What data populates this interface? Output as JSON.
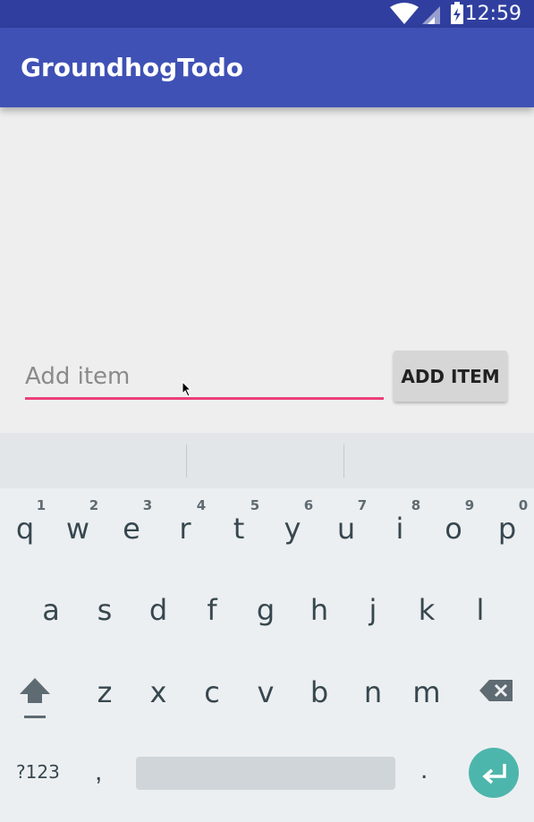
{
  "status_bar": {
    "time": "12:59",
    "icons": [
      "wifi-icon",
      "cell-signal-icon",
      "battery-charging-icon"
    ]
  },
  "app_bar": {
    "title": "GroundhogTodo"
  },
  "form": {
    "placeholder": "Add item",
    "add_button_label": "ADD ITEM"
  },
  "keyboard": {
    "row1": [
      "q",
      "w",
      "e",
      "r",
      "t",
      "y",
      "u",
      "i",
      "o",
      "p"
    ],
    "row1_hints": [
      "1",
      "2",
      "3",
      "4",
      "5",
      "6",
      "7",
      "8",
      "9",
      "0"
    ],
    "row2": [
      "a",
      "s",
      "d",
      "f",
      "g",
      "h",
      "j",
      "k",
      "l"
    ],
    "row3": [
      "z",
      "x",
      "c",
      "v",
      "b",
      "n",
      "m"
    ],
    "symbols_label": "?123",
    "comma": ",",
    "period": "."
  },
  "colors": {
    "app_bar": "#3f51b5",
    "status_bar": "#303f9f",
    "accent": "#ec407a",
    "enter": "#4db6ac"
  }
}
